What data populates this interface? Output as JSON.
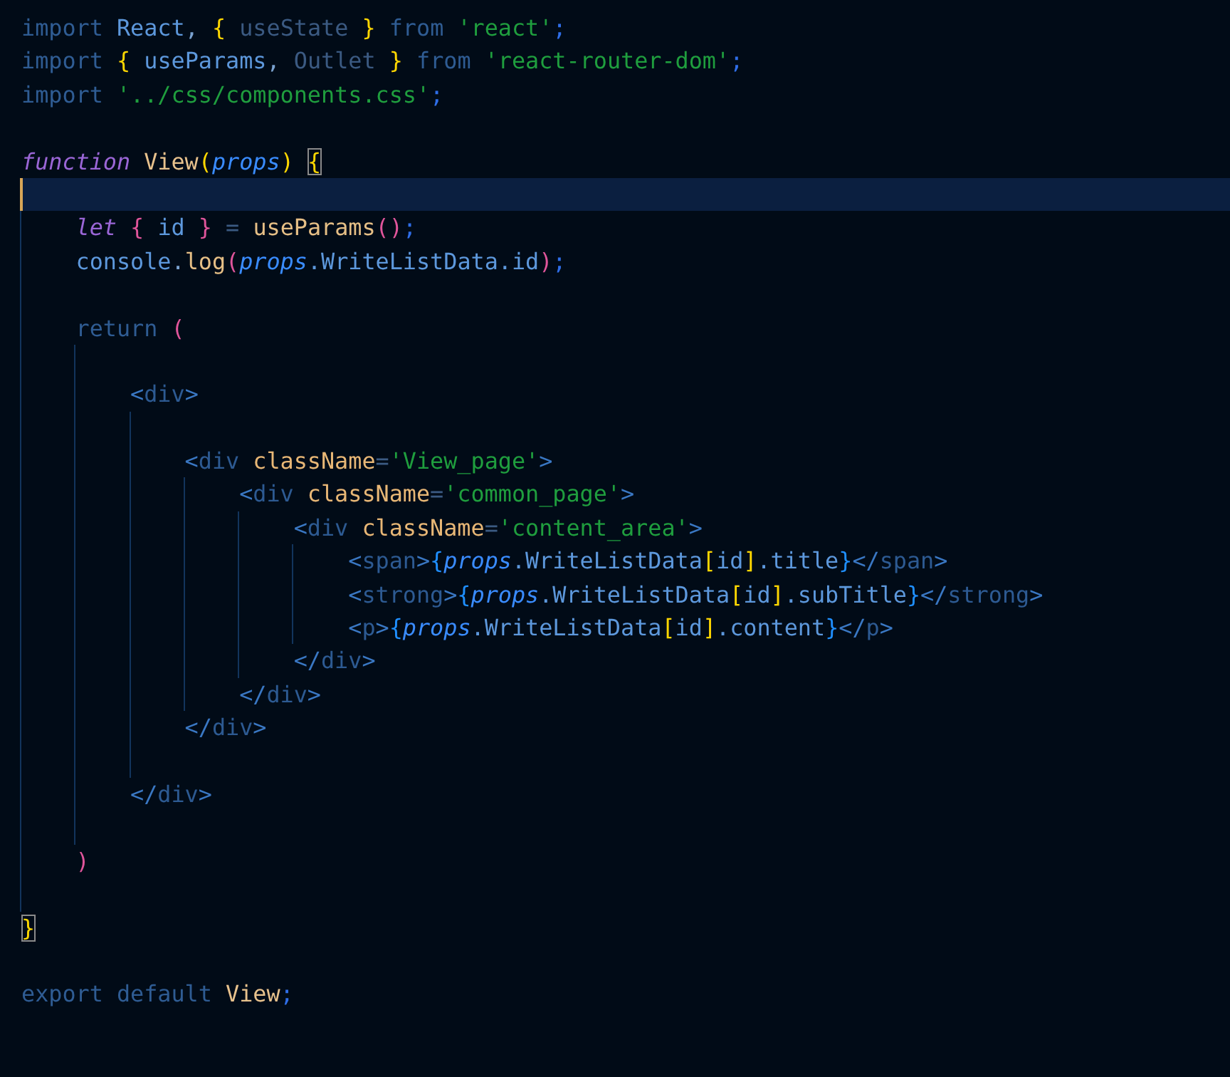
{
  "editor": {
    "lines": [
      {
        "current": false,
        "tokens": [
          {
            "text": "import ",
            "kind": "kw"
          },
          {
            "text": "React",
            "kind": "var"
          },
          {
            "text": ", ",
            "kind": "punct"
          },
          {
            "text": "{",
            "kind": "b1"
          },
          {
            "text": " useState ",
            "kind": "dim"
          },
          {
            "text": "}",
            "kind": "b1"
          },
          {
            "text": " from ",
            "kind": "kw"
          },
          {
            "text": "'react'",
            "kind": "str"
          },
          {
            "text": ";",
            "kind": "semi"
          }
        ]
      },
      {
        "current": false,
        "tokens": [
          {
            "text": "import ",
            "kind": "kw"
          },
          {
            "text": "{",
            "kind": "b1"
          },
          {
            "text": " useParams",
            "kind": "var"
          },
          {
            "text": ", ",
            "kind": "punct"
          },
          {
            "text": "Outlet ",
            "kind": "dim"
          },
          {
            "text": "}",
            "kind": "b1"
          },
          {
            "text": " from ",
            "kind": "kw"
          },
          {
            "text": "'react-router-dom'",
            "kind": "str"
          },
          {
            "text": ";",
            "kind": "semi"
          }
        ]
      },
      {
        "current": false,
        "tokens": [
          {
            "text": "import ",
            "kind": "kw"
          },
          {
            "text": "'../css/components.css'",
            "kind": "str"
          },
          {
            "text": ";",
            "kind": "semi"
          }
        ]
      },
      {
        "current": false
      },
      {
        "current": false,
        "tokens": [
          {
            "text": "function ",
            "kind": "storage"
          },
          {
            "text": "View",
            "kind": "type"
          },
          {
            "text": "(",
            "kind": "b1"
          },
          {
            "text": "props",
            "kind": "param"
          },
          {
            "text": ") ",
            "kind": "b1"
          },
          {
            "text": "{",
            "kind": "match"
          }
        ]
      },
      {
        "current": true
      },
      {
        "current": false,
        "tokens": [
          {
            "text": "    let ",
            "kind": "storage"
          },
          {
            "text": "{",
            "kind": "b2"
          },
          {
            "text": " id ",
            "kind": "var"
          },
          {
            "text": "}",
            "kind": "b2"
          },
          {
            "text": " = ",
            "kind": "dim"
          },
          {
            "text": "useParams",
            "kind": "func"
          },
          {
            "text": "()",
            "kind": "b2"
          },
          {
            "text": ";",
            "kind": "semi"
          }
        ]
      },
      {
        "current": false,
        "tokens": [
          {
            "text": "    console",
            "kind": "var"
          },
          {
            "text": ".",
            "kind": "punct"
          },
          {
            "text": "log",
            "kind": "func"
          },
          {
            "text": "(",
            "kind": "b2"
          },
          {
            "text": "props",
            "kind": "param"
          },
          {
            "text": ".WriteListData.id",
            "kind": "var"
          },
          {
            "text": ")",
            "kind": "b2"
          },
          {
            "text": ";",
            "kind": "semi"
          }
        ]
      },
      {
        "current": false
      },
      {
        "current": false,
        "tokens": [
          {
            "text": "    return ",
            "kind": "kw"
          },
          {
            "text": "(",
            "kind": "b2"
          }
        ]
      },
      {
        "current": false
      },
      {
        "current": false,
        "tokens": [
          {
            "text": "        <",
            "kind": "angle"
          },
          {
            "text": "div",
            "kind": "tag"
          },
          {
            "text": ">",
            "kind": "angle"
          }
        ]
      },
      {
        "current": false
      },
      {
        "current": false,
        "tokens": [
          {
            "text": "            <",
            "kind": "angle"
          },
          {
            "text": "div ",
            "kind": "tag"
          },
          {
            "text": "className",
            "kind": "attr"
          },
          {
            "text": "=",
            "kind": "dim"
          },
          {
            "text": "'View_page'",
            "kind": "str"
          },
          {
            "text": ">",
            "kind": "angle"
          }
        ]
      },
      {
        "current": false,
        "tokens": [
          {
            "text": "                <",
            "kind": "angle"
          },
          {
            "text": "div ",
            "kind": "tag"
          },
          {
            "text": "className",
            "kind": "attr"
          },
          {
            "text": "=",
            "kind": "dim"
          },
          {
            "text": "'common_page'",
            "kind": "str"
          },
          {
            "text": ">",
            "kind": "angle"
          }
        ]
      },
      {
        "current": false,
        "tokens": [
          {
            "text": "                    <",
            "kind": "angle"
          },
          {
            "text": "div ",
            "kind": "tag"
          },
          {
            "text": "className",
            "kind": "attr"
          },
          {
            "text": "=",
            "kind": "dim"
          },
          {
            "text": "'content_area'",
            "kind": "str"
          },
          {
            "text": ">",
            "kind": "angle"
          }
        ]
      },
      {
        "current": false,
        "tokens": [
          {
            "text": "                        <",
            "kind": "angle"
          },
          {
            "text": "span",
            "kind": "tag"
          },
          {
            "text": ">",
            "kind": "angle"
          },
          {
            "text": "{",
            "kind": "b3"
          },
          {
            "text": "props",
            "kind": "param"
          },
          {
            "text": ".WriteListData",
            "kind": "var"
          },
          {
            "text": "[",
            "kind": "b1"
          },
          {
            "text": "id",
            "kind": "var"
          },
          {
            "text": "]",
            "kind": "b1"
          },
          {
            "text": ".title",
            "kind": "var"
          },
          {
            "text": "}",
            "kind": "b3"
          },
          {
            "text": "</",
            "kind": "angle"
          },
          {
            "text": "span",
            "kind": "tag"
          },
          {
            "text": ">",
            "kind": "angle"
          }
        ]
      },
      {
        "current": false,
        "tokens": [
          {
            "text": "                        <",
            "kind": "angle"
          },
          {
            "text": "strong",
            "kind": "tag"
          },
          {
            "text": ">",
            "kind": "angle"
          },
          {
            "text": "{",
            "kind": "b3"
          },
          {
            "text": "props",
            "kind": "param"
          },
          {
            "text": ".WriteListData",
            "kind": "var"
          },
          {
            "text": "[",
            "kind": "b1"
          },
          {
            "text": "id",
            "kind": "var"
          },
          {
            "text": "]",
            "kind": "b1"
          },
          {
            "text": ".subTitle",
            "kind": "var"
          },
          {
            "text": "}",
            "kind": "b3"
          },
          {
            "text": "</",
            "kind": "angle"
          },
          {
            "text": "strong",
            "kind": "tag"
          },
          {
            "text": ">",
            "kind": "angle"
          }
        ]
      },
      {
        "current": false,
        "tokens": [
          {
            "text": "                        <",
            "kind": "angle"
          },
          {
            "text": "p",
            "kind": "tag"
          },
          {
            "text": ">",
            "kind": "angle"
          },
          {
            "text": "{",
            "kind": "b3"
          },
          {
            "text": "props",
            "kind": "param"
          },
          {
            "text": ".WriteListData",
            "kind": "var"
          },
          {
            "text": "[",
            "kind": "b1"
          },
          {
            "text": "id",
            "kind": "var"
          },
          {
            "text": "]",
            "kind": "b1"
          },
          {
            "text": ".content",
            "kind": "var"
          },
          {
            "text": "}",
            "kind": "b3"
          },
          {
            "text": "</",
            "kind": "angle"
          },
          {
            "text": "p",
            "kind": "tag"
          },
          {
            "text": ">",
            "kind": "angle"
          }
        ]
      },
      {
        "current": false,
        "tokens": [
          {
            "text": "                    </",
            "kind": "angle"
          },
          {
            "text": "div",
            "kind": "tag"
          },
          {
            "text": ">",
            "kind": "angle"
          }
        ]
      },
      {
        "current": false,
        "tokens": [
          {
            "text": "                </",
            "kind": "angle"
          },
          {
            "text": "div",
            "kind": "tag"
          },
          {
            "text": ">",
            "kind": "angle"
          }
        ]
      },
      {
        "current": false,
        "tokens": [
          {
            "text": "            </",
            "kind": "angle"
          },
          {
            "text": "div",
            "kind": "tag"
          },
          {
            "text": ">",
            "kind": "angle"
          }
        ]
      },
      {
        "current": false
      },
      {
        "current": false,
        "tokens": [
          {
            "text": "        </",
            "kind": "angle"
          },
          {
            "text": "div",
            "kind": "tag"
          },
          {
            "text": ">",
            "kind": "angle"
          }
        ]
      },
      {
        "current": false
      },
      {
        "current": false,
        "tokens": [
          {
            "text": "    )",
            "kind": "b2"
          }
        ]
      },
      {
        "current": false
      },
      {
        "current": false,
        "tokens": [
          {
            "text": "}",
            "kind": "match"
          }
        ]
      },
      {
        "current": false
      },
      {
        "current": false,
        "tokens": [
          {
            "text": "export default ",
            "kind": "kw"
          },
          {
            "text": "View",
            "kind": "type"
          },
          {
            "text": ";",
            "kind": "semi"
          }
        ]
      }
    ]
  }
}
